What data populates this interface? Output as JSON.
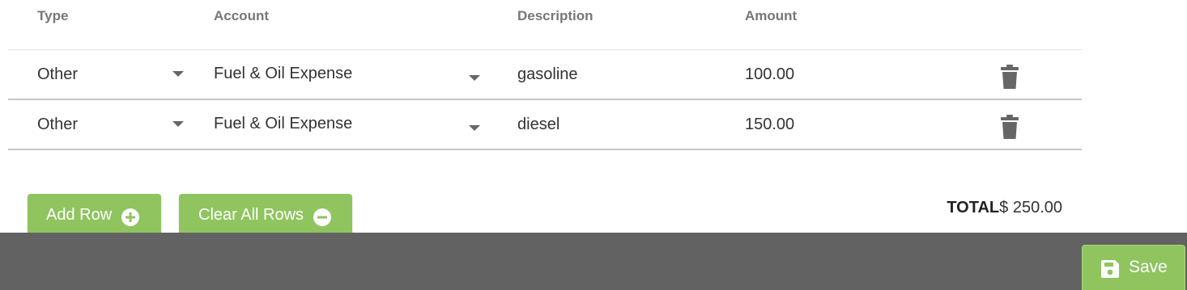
{
  "table": {
    "headers": {
      "type": "Type",
      "account": "Account",
      "description": "Description",
      "amount": "Amount"
    },
    "rows": [
      {
        "type": "Other",
        "account": "Fuel & Oil Expense",
        "description": "gasoline",
        "amount": "100.00",
        "delete_icon": "trash-icon"
      },
      {
        "type": "Other",
        "account": "Fuel & Oil Expense",
        "description": "diesel",
        "amount": "150.00",
        "delete_icon": "trash-icon"
      }
    ]
  },
  "actions": {
    "add_row_label": "Add Row",
    "add_row_icon": "plus-circle-icon",
    "clear_rows_label": "Clear All Rows",
    "clear_rows_icon": "minus-circle-icon"
  },
  "total": {
    "label": "TOTAL",
    "value": "$ 250.00"
  },
  "footer": {
    "save_label": "Save",
    "save_icon": "floppy-disk-icon"
  },
  "colors": {
    "button_green": "#8fc45f",
    "footer_gray": "#626262",
    "icon_gray": "#666666"
  }
}
